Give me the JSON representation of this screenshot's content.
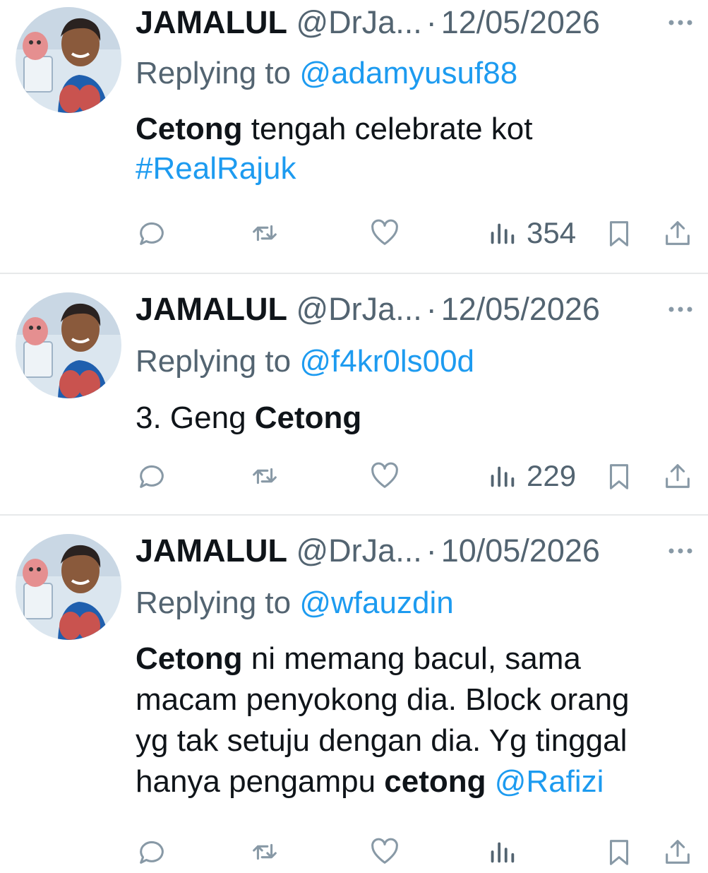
{
  "tweets": [
    {
      "name": "JAMALUL",
      "handle": "@DrJa...",
      "sep": "·",
      "date": "12/05/2026",
      "reply_prefix": "Replying to ",
      "reply_to": "@adamyusuf88",
      "body": {
        "bold1": "Cetong",
        "text1": " tengah celebrate kot",
        "hashtag": "#RealRajuk"
      },
      "views": "354"
    },
    {
      "name": "JAMALUL",
      "handle": "@DrJa...",
      "sep": "·",
      "date": "12/05/2026",
      "reply_prefix": "Replying to ",
      "reply_to": "@f4kr0ls00d",
      "body": {
        "text1": "3. Geng ",
        "bold1": "Cetong"
      },
      "views": "229"
    },
    {
      "name": "JAMALUL",
      "handle": "@DrJa...",
      "sep": "·",
      "date": "10/05/2026",
      "reply_prefix": "Replying to ",
      "reply_to": "@wfauzdin",
      "body": {
        "bold1": "Cetong",
        "line1": " ni memang bacul, sama",
        "line2": "macam penyokong dia. Block orang",
        "line3": "yg tak setuju dengan dia. Yg tinggal",
        "line4": "hanya pengampu ",
        "bold2": "cetong",
        "mention": "@Rafizi"
      }
    }
  ],
  "icons": {
    "more": "more-dots-icon",
    "reply": "reply-bubble-icon",
    "retweet": "retweet-icon",
    "like": "heart-icon",
    "views": "views-bars-icon",
    "bookmark": "bookmark-icon",
    "share": "share-icon"
  },
  "colors": {
    "text": "#0f1419",
    "secondary": "#536471",
    "link": "#1d9bf0",
    "icon": "#8899a6",
    "divider": "#e7e9ea"
  }
}
